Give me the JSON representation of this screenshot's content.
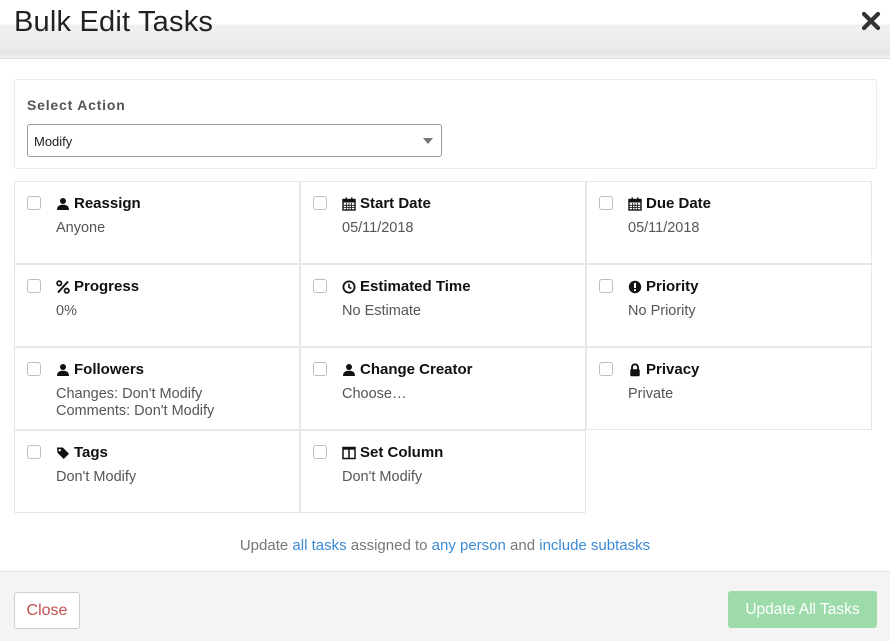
{
  "header": {
    "title": "Bulk Edit Tasks",
    "close_icon": "close-icon"
  },
  "action": {
    "label": "Select Action",
    "selected": "Modify"
  },
  "fields": [
    {
      "title": "Reassign",
      "icon": "user-icon",
      "value": [
        "Anyone"
      ]
    },
    {
      "title": "Start Date",
      "icon": "calendar-icon",
      "value": [
        "05/11/2018"
      ]
    },
    {
      "title": "Due Date",
      "icon": "calendar-icon",
      "value": [
        "05/11/2018"
      ]
    },
    {
      "title": "Progress",
      "icon": "percent-icon",
      "value": [
        "0%"
      ]
    },
    {
      "title": "Estimated Time",
      "icon": "clock-icon",
      "value": [
        "No Estimate"
      ]
    },
    {
      "title": "Priority",
      "icon": "exclamation-icon",
      "value": [
        "No Priority"
      ]
    },
    {
      "title": "Followers",
      "icon": "user-icon",
      "value": [
        "Changes: Don't Modify",
        "Comments: Don't Modify"
      ]
    },
    {
      "title": "Change Creator",
      "icon": "user-icon",
      "value": [
        "Choose…"
      ]
    },
    {
      "title": "Privacy",
      "icon": "lock-icon",
      "value": [
        "Private"
      ]
    },
    {
      "title": "Tags",
      "icon": "tag-icon",
      "value": [
        "Don't Modify"
      ]
    },
    {
      "title": "Set Column",
      "icon": "columns-icon",
      "value": [
        "Don't Modify"
      ]
    }
  ],
  "summary": {
    "t1": "Update ",
    "l1": "all tasks",
    "t2": " assigned to ",
    "l2": "any person",
    "t3": " and ",
    "l3": "include subtasks"
  },
  "footer": {
    "close_label": "Close",
    "update_label": "Update All Tasks"
  },
  "colors": {
    "link": "#3a8ad6",
    "close_text": "#c0504d",
    "update_bg": "#9ddcaa"
  }
}
